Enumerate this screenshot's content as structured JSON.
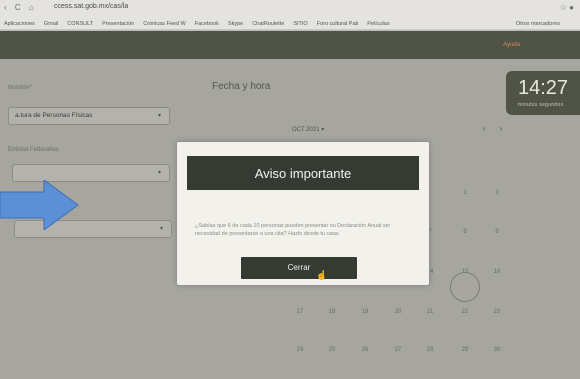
{
  "browser": {
    "url": "ccess.sat.gob.mx/cas/la",
    "nav_icons": "‹ C ⌂",
    "bookmarks": [
      "Aplicaciones",
      "Gmail",
      "CONSULT",
      "Presentación",
      "Crónicas Feed W",
      "Facebook",
      "Skype",
      "ChatRoulette",
      "SITIO",
      "Foro cultural Pati",
      "Películas"
    ],
    "other_bookmarks": "Otros marcadores"
  },
  "header": {
    "help_link": "Ayuda"
  },
  "left_panel": {
    "field1_label": "Nombre*",
    "field1_value": "a.tura de Personas Físicas",
    "field2_label": "Entidad Federativa",
    "field2_value": "",
    "field3_value": ""
  },
  "calendar": {
    "section_title": "Fecha y hora",
    "month": "OCT 2021",
    "prev": "‹",
    "next": "›",
    "rows": [
      [
        "",
        "",
        "",
        "",
        "1",
        "2"
      ],
      [
        "",
        "",
        "",
        "7",
        "8",
        "9"
      ],
      [
        "",
        "",
        "",
        "14",
        "15",
        "16"
      ],
      [
        "17",
        "18",
        "19",
        "20",
        "21",
        "22",
        "23"
      ],
      [
        "24",
        "25",
        "26",
        "27",
        "28",
        "29",
        "30"
      ]
    ]
  },
  "clock": {
    "time": "14:27",
    "labels": "minutos  segundos"
  },
  "modal": {
    "title": "Aviso importante",
    "body": "¿Sabías que 6 de cada 10 personas pueden presentar su Declaración Anual sin necesidad de presentarse a una cita? Hazlo desde tu casa.",
    "button_label": "Cerrar"
  },
  "colors": {
    "header_bg": "#4f5446",
    "modal_header_bg": "#353a33",
    "arrow": "#5b8fd6",
    "help_link": "#d98a52"
  },
  "icons": {
    "arrow": "right-arrow-icon",
    "cursor": "hand-pointer-icon"
  }
}
